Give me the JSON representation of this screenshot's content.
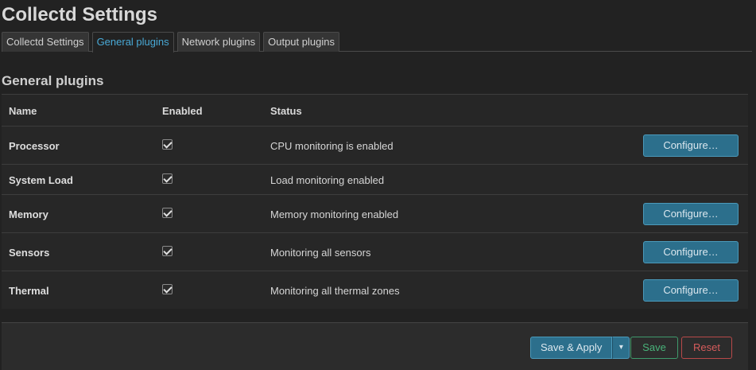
{
  "page": {
    "title": "Collectd Settings"
  },
  "tabs": [
    {
      "label": "Collectd Settings",
      "active": false
    },
    {
      "label": "General plugins",
      "active": true
    },
    {
      "label": "Network plugins",
      "active": false
    },
    {
      "label": "Output plugins",
      "active": false
    }
  ],
  "section": {
    "title": "General plugins"
  },
  "table": {
    "headers": {
      "name": "Name",
      "enabled": "Enabled",
      "status": "Status"
    },
    "rows": [
      {
        "name": "Processor",
        "enabled": true,
        "status": "CPU monitoring is enabled",
        "configure_label": "Configure…"
      },
      {
        "name": "System Load",
        "enabled": true,
        "status": "Load monitoring enabled",
        "configure_label": ""
      },
      {
        "name": "Memory",
        "enabled": true,
        "status": "Memory monitoring enabled",
        "configure_label": "Configure…"
      },
      {
        "name": "Sensors",
        "enabled": true,
        "status": "Monitoring all sensors",
        "configure_label": "Configure…"
      },
      {
        "name": "Thermal",
        "enabled": true,
        "status": "Monitoring all thermal zones",
        "configure_label": "Configure…"
      }
    ]
  },
  "footer": {
    "save_apply_label": "Save & Apply",
    "dropdown_glyph": "▾",
    "save_label": "Save",
    "reset_label": "Reset"
  },
  "colors": {
    "background": "#222222",
    "accent": "#49a9d6",
    "primary_button": "#2c6f8c",
    "save": "#49b37a",
    "reset": "#d65c5c"
  },
  "icons": {
    "checkbox": "checkmark-icon",
    "dropdown": "caret-down-icon"
  }
}
